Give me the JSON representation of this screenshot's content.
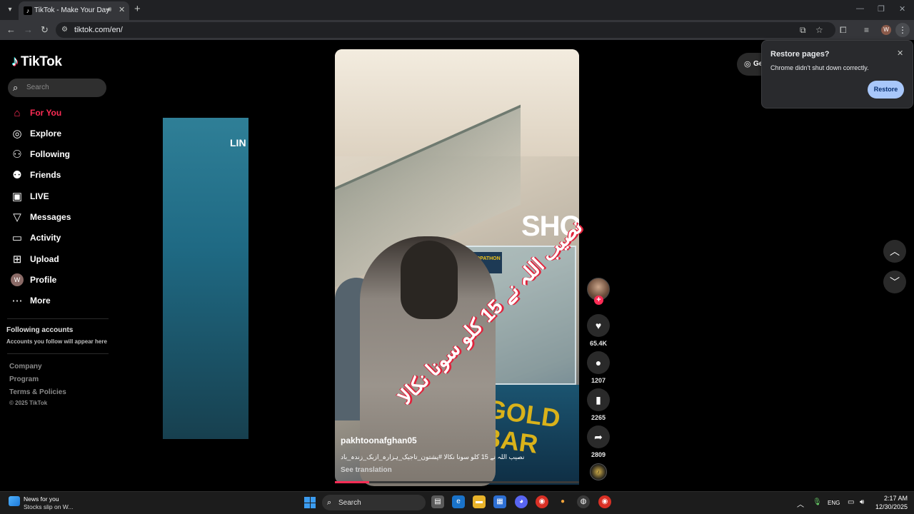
{
  "browser": {
    "tab_title": "TikTok - Make Your Day",
    "url": "tiktok.com/en/",
    "profile_initial": "W",
    "icons": [
      "tab-list-icon",
      "tiktok-favicon",
      "audio-icon",
      "close-icon",
      "new-tab-icon",
      "back-icon",
      "forward-icon",
      "reload-icon",
      "site-info-icon",
      "install-app-icon",
      "bookmark-star-icon",
      "extensions-icon",
      "media-control-icon",
      "menu-icon",
      "minimize-icon",
      "maximize-icon",
      "window-close-icon"
    ]
  },
  "sidebar": {
    "logo_text": "TikTok",
    "search_placeholder": "Search",
    "items": [
      {
        "label": "For You",
        "icon": "home-icon",
        "active": true
      },
      {
        "label": "Explore",
        "icon": "compass-icon"
      },
      {
        "label": "Following",
        "icon": "following-icon"
      },
      {
        "label": "Friends",
        "icon": "friends-icon"
      },
      {
        "label": "LIVE",
        "icon": "live-icon"
      },
      {
        "label": "Messages",
        "icon": "messages-icon"
      },
      {
        "label": "Activity",
        "icon": "activity-icon"
      },
      {
        "label": "Upload",
        "icon": "upload-icon"
      },
      {
        "label": "Profile",
        "icon": "profile-avatar",
        "avatar": "W"
      },
      {
        "label": "More",
        "icon": "more-icon"
      }
    ],
    "following_title": "Following accounts",
    "following_sub": "Accounts you follow will appear here",
    "footer": [
      "Company",
      "Program",
      "Terms & Policies"
    ],
    "copyright": "© 2025 TikTok"
  },
  "video": {
    "handle": "pakhtoonafghan05",
    "caption": "نصیب اللہ نے 15 کلو سونا نکالا #پشتون_تاجیک_ہزارہ_ازبک_زندہ_باد",
    "overlay_text": "نصیب اللہ نے 15 کلو سونا نکالا",
    "see_translation": "See translation",
    "scene_text": {
      "shop": "SHOP",
      "lin": "LIN",
      "shopathon": "SHOPATHON",
      "gold_bar": "GOLD BAR"
    },
    "progress": 0.14
  },
  "actions": {
    "likes": "65.4K",
    "comments": "1207",
    "saves": "2265",
    "shares": "2809"
  },
  "get_app_label": "Get",
  "restore_popup": {
    "title": "Restore pages?",
    "message": "Chrome didn't shut down correctly.",
    "button": "Restore"
  },
  "taskbar": {
    "news_title": "News for you",
    "news_sub": "Stocks slip on W...",
    "search_label": "Search",
    "lang": "ENG",
    "time": "2:17 AM",
    "date": "12/30/2025"
  },
  "colors": {
    "accent": "#fe2c55",
    "restore_button": "#a8c7fa",
    "page_bg": "#000000"
  }
}
